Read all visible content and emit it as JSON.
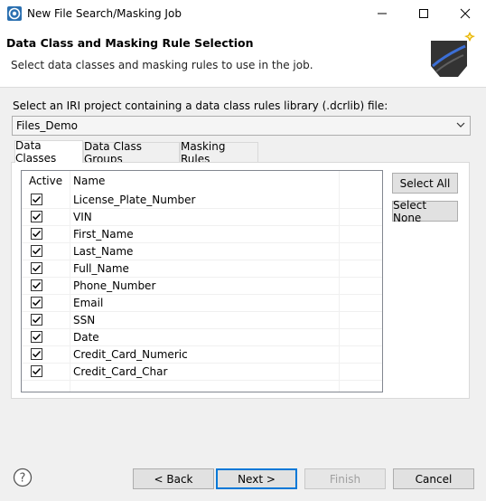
{
  "window": {
    "title": "New File Search/Masking Job"
  },
  "header": {
    "title": "Data Class and Masking Rule Selection",
    "subtitle": "Select data classes and masking rules to use in the job."
  },
  "project": {
    "label": "Select an IRI project containing a data class rules library (.dcrlib) file:",
    "selected": "Files_Demo"
  },
  "tabs": [
    {
      "label": "Data Classes",
      "active": true
    },
    {
      "label": "Data Class Groups",
      "active": false
    },
    {
      "label": "Masking Rules",
      "active": false
    }
  ],
  "table": {
    "columns": [
      "Active",
      "Name"
    ],
    "rows": [
      {
        "active": true,
        "name": "License_Plate_Number"
      },
      {
        "active": true,
        "name": "VIN"
      },
      {
        "active": true,
        "name": "First_Name"
      },
      {
        "active": true,
        "name": "Last_Name"
      },
      {
        "active": true,
        "name": "Full_Name"
      },
      {
        "active": true,
        "name": "Phone_Number"
      },
      {
        "active": true,
        "name": "Email"
      },
      {
        "active": true,
        "name": "SSN"
      },
      {
        "active": true,
        "name": "Date"
      },
      {
        "active": true,
        "name": "Credit_Card_Numeric"
      },
      {
        "active": true,
        "name": "Credit_Card_Char"
      }
    ]
  },
  "side_buttons": {
    "select_all": "Select All",
    "select_none": "Select None"
  },
  "footer": {
    "back": "< Back",
    "next": "Next >",
    "finish": "Finish",
    "cancel": "Cancel",
    "finish_enabled": false
  },
  "colors": {
    "accent": "#0078d7",
    "banner_bg": "#ffffff",
    "dialog_bg": "#f0f0f0"
  }
}
